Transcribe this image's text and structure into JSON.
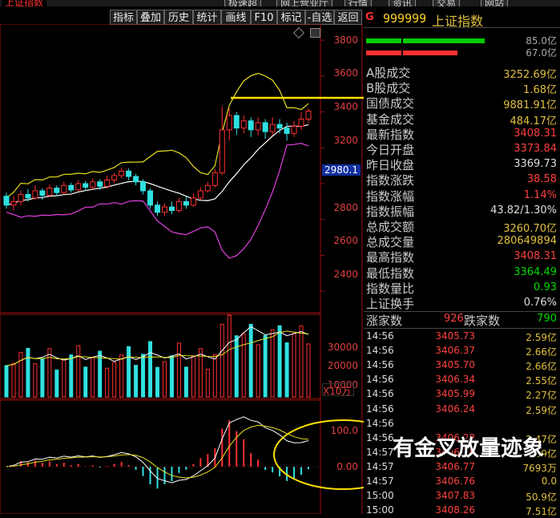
{
  "top_strip": {
    "title": "上证指数",
    "tabs": [
      "极速超",
      "网上营业厅",
      "行情",
      "资讯",
      "交易",
      "网站"
    ]
  },
  "toolbar": {
    "buttons": [
      "指标",
      "叠加",
      "历史",
      "统计",
      "画线",
      "F10",
      "标记",
      "-自选",
      "返回"
    ]
  },
  "header": {
    "market_icon": "G",
    "code": "999999",
    "name": "上证指数"
  },
  "price_axis": [
    "3800",
    "3600",
    "3400",
    "3200",
    "3000",
    "2800",
    "2600",
    "2400"
  ],
  "current_price_marker": "2980.1",
  "volume_axis": [
    "30000",
    "20000",
    "10000"
  ],
  "volume_unit": "X10万",
  "macd_axis": [
    "100.0",
    "0.00"
  ],
  "annotation": "有金叉放量迹象",
  "strength_bars": {
    "upper_value": "85.0亿",
    "lower_value": "67.0亿",
    "colors": {
      "upper": "#00cc00",
      "lower": "#ff3030"
    }
  },
  "stats": [
    {
      "label": "A股成交",
      "value": "3252.69亿",
      "color": "#e0c040"
    },
    {
      "label": "B股成交",
      "value": "1.68亿",
      "color": "#e0c040"
    },
    {
      "label": "国债成交",
      "value": "9881.91亿",
      "color": "#e0c040"
    },
    {
      "label": "基金成交",
      "value": "484.17亿",
      "color": "#e0c040"
    },
    {
      "label": "最新指数",
      "value": "3408.31",
      "color": "#ff4040"
    },
    {
      "label": "今日开盘",
      "value": "3373.84",
      "color": "#ff4040"
    },
    {
      "label": "昨日收盘",
      "value": "3369.73",
      "color": "#dddddd"
    },
    {
      "label": "指数涨跌",
      "value": "38.58",
      "color": "#ff4040"
    },
    {
      "label": "指数涨幅",
      "value": "1.14%",
      "color": "#ff4040"
    },
    {
      "label": "指数振幅",
      "value": "43.82/1.30%",
      "color": "#dddddd"
    },
    {
      "label": "总成交额",
      "value": "3260.70亿",
      "color": "#e0c040"
    },
    {
      "label": "总成交量",
      "value": "280649894",
      "color": "#e0c040"
    },
    {
      "label": "最高指数",
      "value": "3408.31",
      "color": "#ff4040"
    },
    {
      "label": "最低指数",
      "value": "3364.49",
      "color": "#00dd00"
    },
    {
      "label": "指数量比",
      "value": "0.93",
      "color": "#00dd00"
    },
    {
      "label": "上证换手",
      "value": "0.76%",
      "color": "#dddddd"
    }
  ],
  "breadth": {
    "up_label": "涨家数",
    "up_value": "926",
    "down_label": "跌家数",
    "down_value": "790"
  },
  "ticks": [
    {
      "time": "14:56",
      "price": "3405.73",
      "vol": "2.59亿"
    },
    {
      "time": "14:56",
      "price": "3406.37",
      "vol": "2.66亿"
    },
    {
      "time": "14:56",
      "price": "3405.70",
      "vol": "2.66亿"
    },
    {
      "time": "14:56",
      "price": "3406.34",
      "vol": "2.55亿"
    },
    {
      "time": "14:56",
      "price": "3405.99",
      "vol": "2.27亿"
    },
    {
      "time": "14:56",
      "price": "3406.24",
      "vol": "2.59亿"
    },
    {
      "time": "14:56",
      "price": "",
      "vol": ""
    },
    {
      "time": "14:56",
      "price": "3406.28",
      "vol": "2.47亿"
    },
    {
      "time": "14:57",
      "price": "3406.18",
      "vol": "2.39亿"
    },
    {
      "time": "14:57",
      "price": "3406.77",
      "vol": "7693万"
    },
    {
      "time": "14:57",
      "price": "3406.76",
      "vol": "0.0"
    },
    {
      "time": "15:00",
      "price": "3407.83",
      "vol": "50.9亿"
    },
    {
      "time": "15:00",
      "price": "3408.26",
      "vol": "7.51亿"
    }
  ],
  "chart_data": {
    "type": "candlestick",
    "price_axis_ticks": [
      3800,
      3600,
      3400,
      3200,
      3000,
      2800,
      2600,
      2400
    ],
    "ylim": [
      2280,
      3890
    ],
    "candles": [
      [
        2930,
        2880,
        2950,
        2860
      ],
      [
        2880,
        2900,
        2930,
        2850
      ],
      [
        2900,
        2940,
        2960,
        2880
      ],
      [
        2940,
        2920,
        2970,
        2900
      ],
      [
        2920,
        2960,
        2990,
        2910
      ],
      [
        2960,
        2935,
        2975,
        2910
      ],
      [
        2935,
        2975,
        2995,
        2925
      ],
      [
        2975,
        2950,
        2990,
        2930
      ],
      [
        2950,
        2990,
        3010,
        2940
      ],
      [
        2990,
        2965,
        3005,
        2950
      ],
      [
        2965,
        3000,
        3020,
        2955
      ],
      [
        3000,
        2980,
        3015,
        2960
      ],
      [
        2980,
        3010,
        3030,
        2970
      ],
      [
        3010,
        2985,
        3025,
        2965
      ],
      [
        2985,
        3020,
        3045,
        2975
      ],
      [
        3020,
        3045,
        3060,
        3005
      ],
      [
        3045,
        3070,
        3090,
        3030
      ],
      [
        3070,
        3040,
        3085,
        3020
      ],
      [
        3040,
        3010,
        3055,
        2990
      ],
      [
        3010,
        2960,
        3025,
        2940
      ],
      [
        2960,
        2880,
        2975,
        2860
      ],
      [
        2880,
        2840,
        2900,
        2820
      ],
      [
        2840,
        2870,
        2890,
        2820
      ],
      [
        2870,
        2850,
        2900,
        2830
      ],
      [
        2850,
        2900,
        2920,
        2840
      ],
      [
        2900,
        2880,
        2930,
        2860
      ],
      [
        2880,
        2920,
        2945,
        2870
      ],
      [
        2920,
        2960,
        2980,
        2910
      ],
      [
        2960,
        2990,
        3010,
        2950
      ],
      [
        2990,
        3060,
        3080,
        2980
      ],
      [
        3060,
        3300,
        3430,
        3050
      ],
      [
        3300,
        3380,
        3420,
        3240
      ],
      [
        3380,
        3310,
        3400,
        3270
      ],
      [
        3310,
        3350,
        3380,
        3280
      ],
      [
        3350,
        3300,
        3370,
        3260
      ],
      [
        3300,
        3340,
        3370,
        3270
      ],
      [
        3340,
        3290,
        3360,
        3250
      ],
      [
        3290,
        3330,
        3370,
        3270
      ],
      [
        3330,
        3310,
        3360,
        3280
      ],
      [
        3310,
        3280,
        3340,
        3240
      ],
      [
        3280,
        3320,
        3350,
        3260
      ],
      [
        3320,
        3360,
        3400,
        3300
      ],
      [
        3360,
        3405,
        3420,
        3340
      ]
    ]
  }
}
